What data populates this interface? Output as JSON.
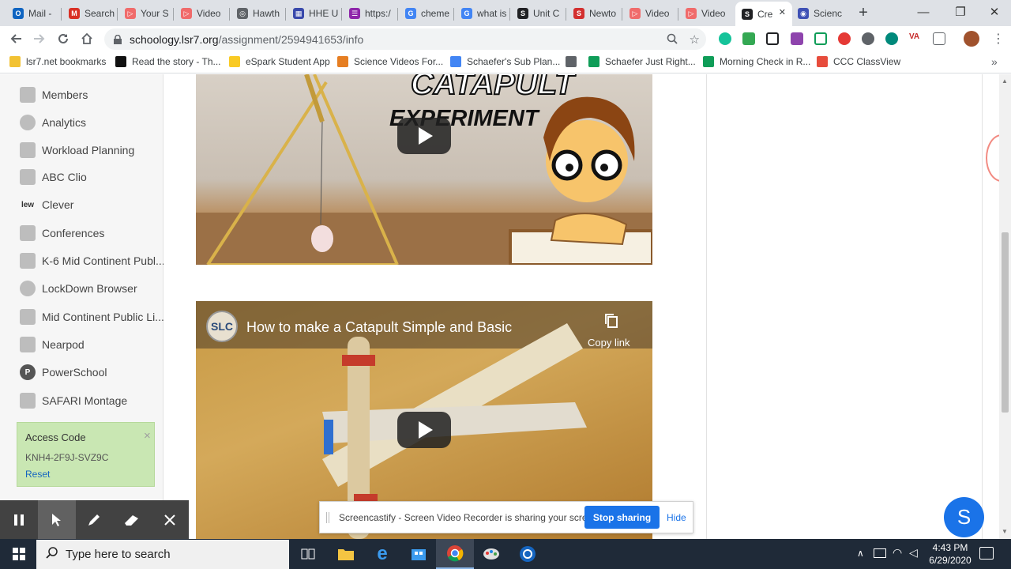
{
  "browser": {
    "tabs": [
      {
        "title": "Mail -",
        "color": "#0f64c1",
        "glyph": "O"
      },
      {
        "title": "Search",
        "color": "#d93025",
        "glyph": "M"
      },
      {
        "title": "Your S",
        "color": "#f06b6b",
        "glyph": "▷"
      },
      {
        "title": "Video",
        "color": "#f06b6b",
        "glyph": "▷"
      },
      {
        "title": "Hawth",
        "color": "#5f6368",
        "glyph": "◎"
      },
      {
        "title": "HHE U",
        "color": "#3949ab",
        "glyph": "▦"
      },
      {
        "title": "https:/",
        "color": "#8e24aa",
        "glyph": "☰"
      },
      {
        "title": "cheme",
        "color": "#4285f4",
        "glyph": "G"
      },
      {
        "title": "what is",
        "color": "#4285f4",
        "glyph": "G"
      },
      {
        "title": "Unit C",
        "color": "#202124",
        "glyph": "S"
      },
      {
        "title": "Newto",
        "color": "#d32f2f",
        "glyph": "S"
      },
      {
        "title": "Video",
        "color": "#f06b6b",
        "glyph": "▷"
      },
      {
        "title": "Video",
        "color": "#f06b6b",
        "glyph": "▷"
      },
      {
        "title": "Cre",
        "color": "#202124",
        "glyph": "S"
      },
      {
        "title": "Scienc",
        "color": "#3f51b5",
        "glyph": "◉"
      }
    ],
    "new_tab_glyph": "+",
    "window_controls": {
      "minimize": "—",
      "maximize": "❐",
      "close": "✕"
    },
    "address": {
      "host": "schoology.lsr7.org",
      "path": "/assignment/2594941653/info"
    },
    "bookmarks": [
      {
        "label": "lsr7.net bookmarks",
        "color": "#f2c233"
      },
      {
        "label": "Read the story - Th...",
        "color": "#111111"
      },
      {
        "label": "eSpark Student App",
        "color": "#f9ca24"
      },
      {
        "label": "Science Videos For...",
        "color": "#e67e22"
      },
      {
        "label": "Schaefer's Sub Plan...",
        "color": "#4285f4"
      },
      {
        "label": "",
        "color": "#5f6368"
      },
      {
        "label": "Schaefer Just Right...",
        "color": "#0f9d58"
      },
      {
        "label": "Morning Check in R...",
        "color": "#0f9d58"
      },
      {
        "label": "CCC ClassView",
        "color": "#e74c3c"
      }
    ],
    "bookmarks_overflow": "»"
  },
  "sidebar": {
    "items": [
      {
        "label": "Members"
      },
      {
        "label": "Analytics"
      },
      {
        "label": "Workload Planning"
      },
      {
        "label": "ABC Clio"
      },
      {
        "label": "Clever",
        "icon_text": "lew"
      },
      {
        "label": "Conferences"
      },
      {
        "label": "K-6 Mid Continent Publ..."
      },
      {
        "label": "LockDown Browser"
      },
      {
        "label": "Mid Continent Public Li..."
      },
      {
        "label": "Nearpod"
      },
      {
        "label": "PowerSchool",
        "icon_text": "P"
      },
      {
        "label": "SAFARI Montage"
      }
    ],
    "access_code": {
      "title": "Access Code",
      "code": "KNH4-2F9J-SVZ9C",
      "reset": "Reset",
      "close": "×"
    }
  },
  "videos": [
    {
      "title_overlay_1": "CATAPULT",
      "title_overlay_2": "EXPERIMENT"
    },
    {
      "channel_badge": "SLC",
      "title": "How to make a Catapult Simple and Basic",
      "copy_link": "Copy link"
    }
  ],
  "screencastify": {
    "share_text": "Screencastify - Screen Video Recorder is sharing your screen.",
    "stop_button": "Stop sharing",
    "hide_link": "Hide",
    "fab_letter": "S"
  },
  "taskbar": {
    "search_placeholder": "Type here to search",
    "time": "4:43 PM",
    "date": "6/29/2020"
  }
}
